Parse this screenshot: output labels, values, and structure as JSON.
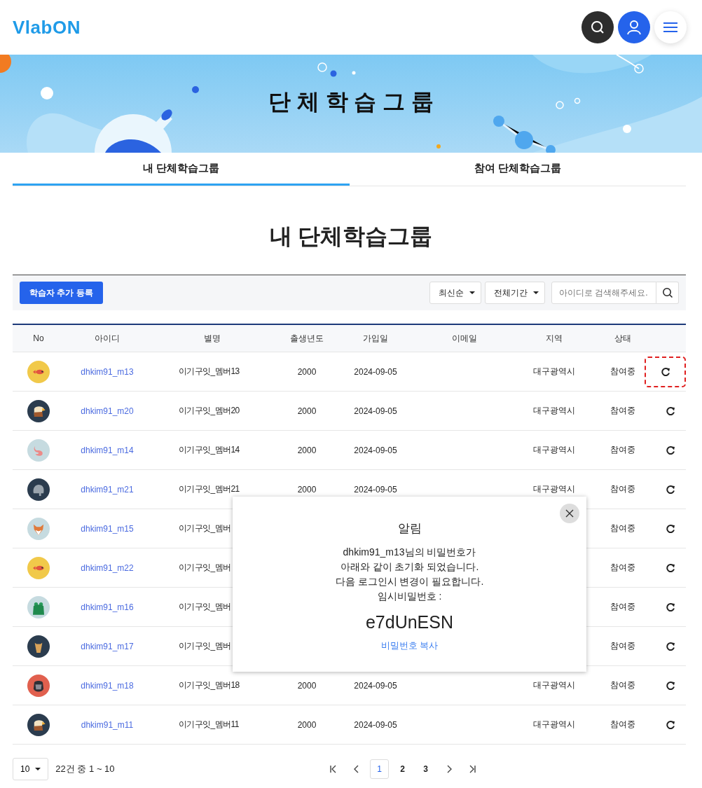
{
  "header": {
    "logo": "VlabON"
  },
  "banner": {
    "title": "단 체 학 습 그 룹"
  },
  "tabs": [
    {
      "label": "내 단체학습그룹",
      "selected": true
    },
    {
      "label": "참여 단체학습그룹",
      "selected": false
    }
  ],
  "page_title": "내 단체학습그룹",
  "toolbar": {
    "add_button": "학습자 추가 등록",
    "sort": "최신순",
    "period": "전체기간",
    "search": {
      "placeholder": "아이디로 검색해주세요."
    }
  },
  "table": {
    "columns": [
      "No",
      "아이디",
      "별명",
      "출생년도",
      "가입일",
      "이메일",
      "지역",
      "상태"
    ],
    "rows": [
      {
        "avatar": {
          "kind": "fish"
        },
        "id": "dhkim91_m13",
        "nickname": "이기구잇_멤버13",
        "birth_year": "2000",
        "joined": "2024-09-05",
        "region": "대구광역시",
        "status": "참여중",
        "highlighted": true
      },
      {
        "avatar": {
          "kind": "eagle"
        },
        "id": "dhkim91_m20",
        "nickname": "이기구잇_멤버20",
        "birth_year": "2000",
        "joined": "2024-09-05",
        "region": "대구광역시",
        "status": "참여중",
        "highlighted": false
      },
      {
        "avatar": {
          "kind": "flamingo"
        },
        "id": "dhkim91_m14",
        "nickname": "이기구잇_멤버14",
        "birth_year": "2000",
        "joined": "2024-09-05",
        "region": "대구광역시",
        "status": "참여중",
        "highlighted": false
      },
      {
        "avatar": {
          "kind": "elephant"
        },
        "id": "dhkim91_m21",
        "nickname": "이기구잇_멤버21",
        "birth_year": "2000",
        "joined": "2024-09-05",
        "region": "대구광역시",
        "status": "참여중",
        "highlighted": false
      },
      {
        "avatar": {
          "kind": "fox"
        },
        "id": "dhkim91_m15",
        "nickname": "이기구잇_멤버",
        "status": "참여중",
        "highlighted": false
      },
      {
        "avatar": {
          "kind": "fish"
        },
        "id": "dhkim91_m22",
        "nickname": "이기구잇_멤버",
        "status": "참여중",
        "highlighted": false
      },
      {
        "avatar": {
          "kind": "frog"
        },
        "id": "dhkim91_m16",
        "nickname": "이기구잇_멤버",
        "status": "참여중",
        "highlighted": false
      },
      {
        "avatar": {
          "kind": "giraffe"
        },
        "id": "dhkim91_m17",
        "nickname": "이기구잇_멤버",
        "status": "참여중",
        "highlighted": false
      },
      {
        "avatar": {
          "kind": "gorilla"
        },
        "id": "dhkim91_m18",
        "nickname": "이기구잇_멤버18",
        "birth_year": "2000",
        "joined": "2024-09-05",
        "region": "대구광역시",
        "status": "참여중",
        "highlighted": false
      },
      {
        "avatar": {
          "kind": "eagle"
        },
        "id": "dhkim91_m11",
        "nickname": "이기구잇_멤버11",
        "birth_year": "2000",
        "joined": "2024-09-05",
        "region": "대구광역시",
        "status": "참여중",
        "highlighted": false
      }
    ]
  },
  "pagination": {
    "page_size": "10",
    "summary": "22건 중 1 ~ 10",
    "pages": [
      {
        "label": "1",
        "selected": true
      },
      {
        "label": "2",
        "selected": false
      },
      {
        "label": "3",
        "selected": false
      }
    ]
  },
  "modal": {
    "title": "알림",
    "message_lines": [
      "dhkim91_m13님의 비밀번호가",
      "아래와 같이 초기화 되었습니다.",
      "다음 로그인시 변경이 필요합니다.",
      "임시비밀번호 :"
    ],
    "password": "e7dUnESN",
    "copy_link": "비밀번호 복사"
  }
}
